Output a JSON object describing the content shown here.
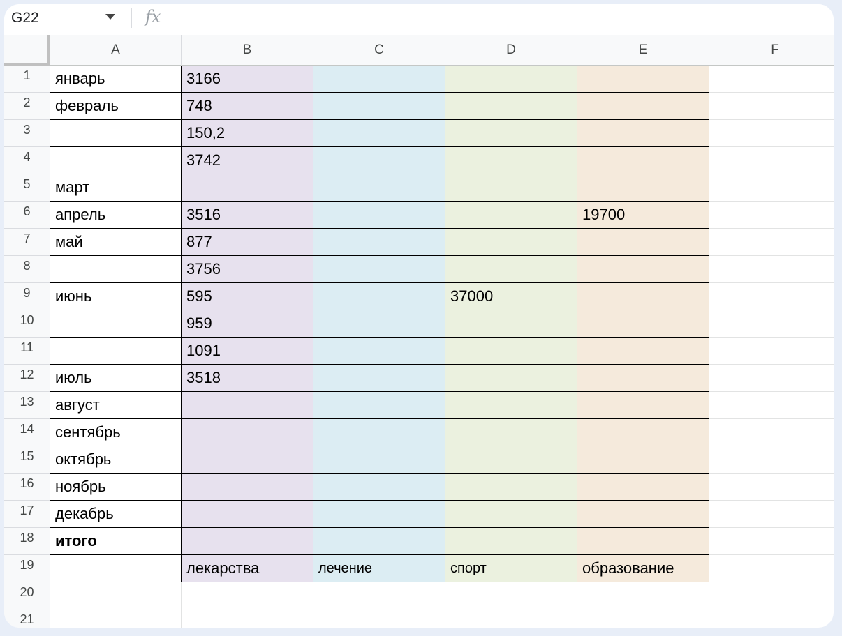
{
  "formula_bar": {
    "cell_ref": "G22",
    "fx_label": "fx"
  },
  "columns": [
    "A",
    "B",
    "C",
    "D",
    "E",
    "F"
  ],
  "rows": [
    {
      "n": "1",
      "A": "январь",
      "B": "3166",
      "C": "",
      "D": "",
      "E": ""
    },
    {
      "n": "2",
      "A": "февраль",
      "B": "748",
      "C": "",
      "D": "",
      "E": ""
    },
    {
      "n": "3",
      "A": "",
      "B": "150,2",
      "C": "",
      "D": "",
      "E": ""
    },
    {
      "n": "4",
      "A": "",
      "B": "3742",
      "C": "",
      "D": "",
      "E": ""
    },
    {
      "n": "5",
      "A": "март",
      "B": "",
      "C": "",
      "D": "",
      "E": ""
    },
    {
      "n": "6",
      "A": "апрель",
      "B": "3516",
      "C": "",
      "D": "",
      "E": "19700"
    },
    {
      "n": "7",
      "A": "май",
      "B": "877",
      "C": "",
      "D": "",
      "E": ""
    },
    {
      "n": "8",
      "A": "",
      "B": "3756",
      "C": "",
      "D": "",
      "E": ""
    },
    {
      "n": "9",
      "A": "июнь",
      "B": "595",
      "C": "",
      "D": "37000",
      "E": ""
    },
    {
      "n": "10",
      "A": "",
      "B": "959",
      "C": "",
      "D": "",
      "E": ""
    },
    {
      "n": "11",
      "A": "",
      "B": "1091",
      "C": "",
      "D": "",
      "E": ""
    },
    {
      "n": "12",
      "A": "июль",
      "B": "3518",
      "C": "",
      "D": "",
      "E": ""
    },
    {
      "n": "13",
      "A": "август",
      "B": "",
      "C": "",
      "D": "",
      "E": ""
    },
    {
      "n": "14",
      "A": "сентябрь",
      "B": "",
      "C": "",
      "D": "",
      "E": ""
    },
    {
      "n": "15",
      "A": "октябрь",
      "B": "",
      "C": "",
      "D": "",
      "E": ""
    },
    {
      "n": "16",
      "A": "ноябрь",
      "B": "",
      "C": "",
      "D": "",
      "E": ""
    },
    {
      "n": "17",
      "A": "декабрь",
      "B": "",
      "C": "",
      "D": "",
      "E": ""
    },
    {
      "n": "18",
      "A": "итого",
      "B": "",
      "C": "",
      "D": "",
      "E": ""
    },
    {
      "n": "19",
      "A": "",
      "B": "лекарства",
      "C": "лечение",
      "D": "спорт",
      "E": "образование"
    },
    {
      "n": "20",
      "A": "",
      "B": "",
      "C": "",
      "D": "",
      "E": ""
    },
    {
      "n": "21",
      "A": "",
      "B": "",
      "C": "",
      "D": "",
      "E": ""
    }
  ],
  "colors": {
    "B": "#e7e1ee",
    "C": "#dcedf3",
    "D": "#ebf1df",
    "E": "#f5eadc"
  }
}
